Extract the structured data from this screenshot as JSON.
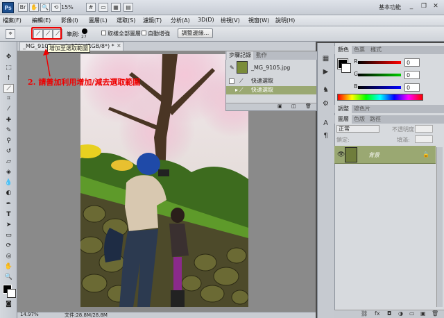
{
  "app": {
    "logo": "Ps",
    "zoom": "15%",
    "workspace": "基本功能"
  },
  "menu": [
    "檔案(F)",
    "編輯(E)",
    "影像(I)",
    "圖層(L)",
    "選取(S)",
    "濾鏡(T)",
    "分析(A)",
    "3D(D)",
    "檢視(V)",
    "視窗(W)",
    "說明(H)"
  ],
  "options": {
    "brush_label": "筆刷:",
    "brush_size": "27",
    "sample_all": "取樣全部圖層",
    "auto_enhance": "自動增強",
    "refine_edge": "調整邊緣..."
  },
  "document": {
    "tab_title": "_MG_9105.jpg @ 15% (RGB/8*) *",
    "tooltip": "增加至選取範圍",
    "zoom_status": "14.97%",
    "doc_info": "文件:28.8M/28.8M"
  },
  "annotation": "2. 請善加利用增加/減去選取範圍",
  "history": {
    "tabs": [
      "步驟記錄",
      "動作"
    ],
    "file": "_MG_9105.jpg",
    "steps": [
      "快速選取",
      "快速選取"
    ]
  },
  "color_panel": {
    "tabs": [
      "顏色",
      "色票",
      "樣式"
    ],
    "channels": [
      {
        "label": "R",
        "value": "0",
        "color": "#e00000"
      },
      {
        "label": "G",
        "value": "0",
        "color": "#00b000"
      },
      {
        "label": "B",
        "value": "0",
        "color": "#0030e0"
      }
    ]
  },
  "adjust_tabs": [
    "調整",
    "遮色片"
  ],
  "layers_panel": {
    "tabs": [
      "圖層",
      "色版",
      "路徑"
    ],
    "blend_mode": "正常",
    "opacity_label": "不透明度:",
    "lock_label": "鎖定:",
    "fill_label": "填滿:",
    "layer_name": "背景"
  },
  "colors": {
    "accent": "#e00000",
    "selected_row": "#9aa872"
  }
}
